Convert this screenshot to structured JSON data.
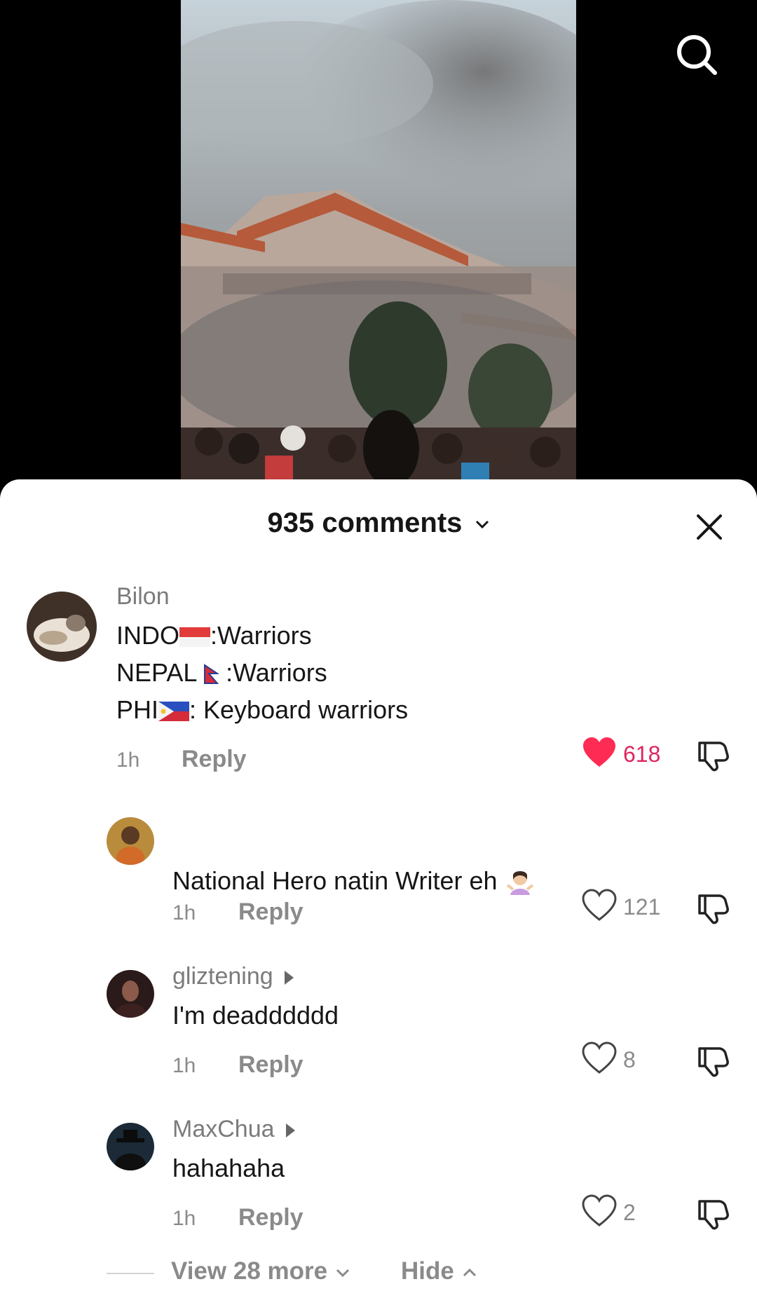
{
  "header": {
    "comment_count_label": "935 comments"
  },
  "comments": [
    {
      "username": "Bilon",
      "lines": [
        {
          "prefix": "INDO",
          "suffix": ":Warriors"
        },
        {
          "prefix": "NEPAL ",
          "suffix": " :Warriors"
        },
        {
          "prefix": "PHI",
          "suffix": ": Keyboard warriors"
        }
      ],
      "time": "1h",
      "reply_label": "Reply",
      "likes": "618"
    },
    {
      "username": "",
      "text": "National Hero natin Writer eh",
      "time": "1h",
      "reply_label": "Reply",
      "likes": "121"
    },
    {
      "username": "gliztening",
      "text": "I'm deadddddd",
      "time": "1h",
      "reply_label": "Reply",
      "likes": "8"
    },
    {
      "username": "MaxChua",
      "text": "hahahaha",
      "time": "1h",
      "reply_label": "Reply",
      "likes": "2"
    }
  ],
  "replies_footer": {
    "view_more_label": "View 28 more",
    "hide_label": "Hide"
  },
  "colors": {
    "like_active": "#fe2c55",
    "text_primary": "#161616",
    "text_secondary": "#8a8a8a"
  },
  "icons": [
    "search-icon",
    "close-icon",
    "chevron-down-icon",
    "heart-icon",
    "dislike-icon",
    "play-arrow-icon",
    "chevron-up-icon"
  ]
}
